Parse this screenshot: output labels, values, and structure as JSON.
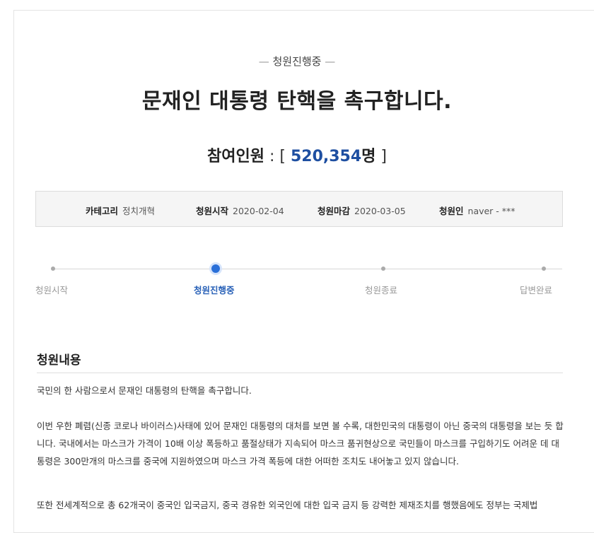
{
  "petition": {
    "status": "청원진행중",
    "title": "문재인 대통령 탄핵을 촉구합니다.",
    "participants_label": "참여인원",
    "participants_colon": " : [ ",
    "participants_count": "520,354",
    "participants_unit": "명",
    "participants_close": " ]"
  },
  "info": {
    "category_label": "카테고리",
    "category_value": "정치개혁",
    "start_label": "청원시작",
    "start_value": "2020-02-04",
    "end_label": "청원마감",
    "end_value": "2020-03-05",
    "author_label": "청원인",
    "author_value": "naver - ***"
  },
  "progress": {
    "steps": [
      {
        "label": "청원시작",
        "active": false
      },
      {
        "label": "청원진행중",
        "active": true
      },
      {
        "label": "청원종료",
        "active": false
      },
      {
        "label": "답변완료",
        "active": false
      }
    ]
  },
  "content": {
    "heading": "청원내용",
    "paragraphs": [
      "국민의 한 사람으로서 문재인 대통령의 탄핵을 촉구합니다.",
      "이번 우한 폐렴(신종 코로나 바이러스)사태에 있어 문재인 대통령의 대처를 보면 볼 수록, 대한민국의 대통령이 아닌 중국의 대통령을 보는 듯 합니다. 국내에서는 마스크가 가격이 10배 이상 폭등하고 품절상태가 지속되어 마스크 품귀현상으로 국민들이 마스크를 구입하기도 어려운 데 대통령은 300만개의 마스크를 중국에 지원하였으며 마스크 가격 폭등에 대한 어떠한 조치도 내어놓고 있지 않습니다.",
      "또한 전세계적으로 총 62개국이 중국인 입국금지, 중국 경유한 외국인에 대한 입국 금지 등 강력한 제재조치를 행했음에도 정부는 국제법"
    ]
  },
  "colors": {
    "accent": "#1e4fa1",
    "active_step": "#2a6fd8"
  }
}
